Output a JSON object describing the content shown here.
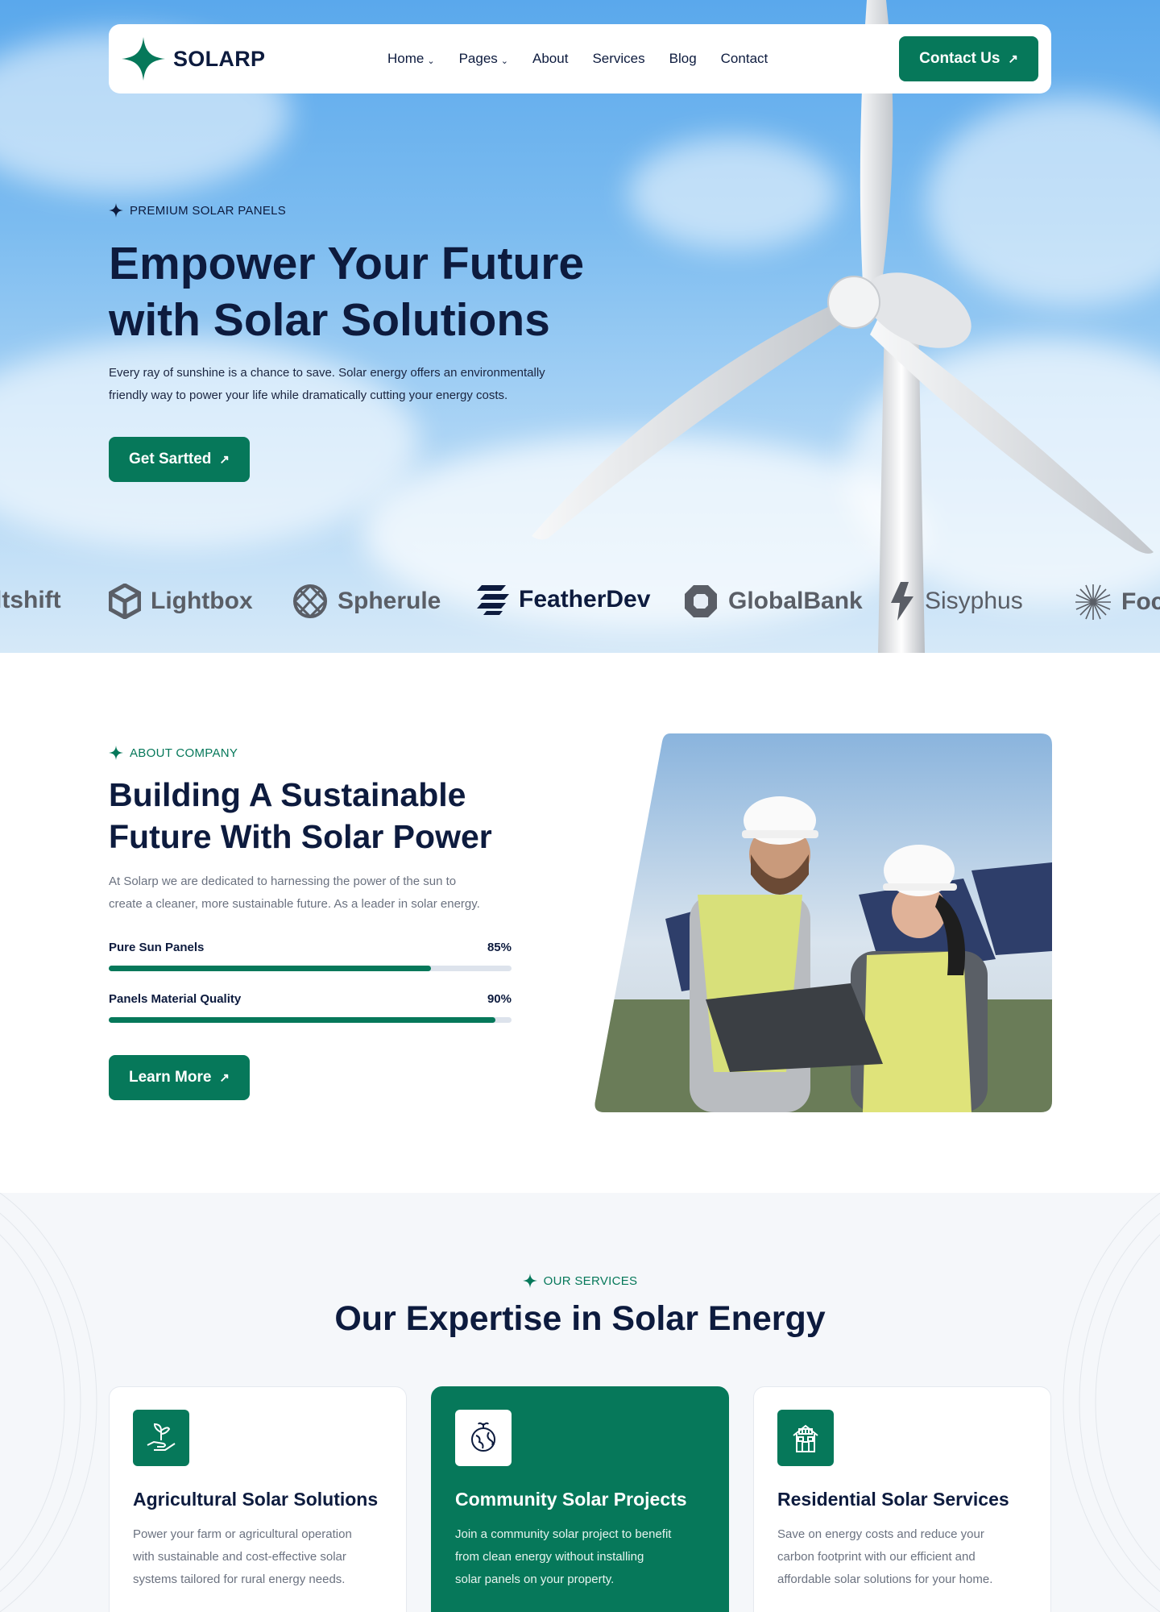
{
  "colors": {
    "brand_green": "#06785a",
    "navy": "#0d1b3e",
    "muted": "#6b7280"
  },
  "nav": {
    "logo_text": "SOLARP",
    "links": [
      {
        "label": "Home",
        "dropdown": true
      },
      {
        "label": "Pages",
        "dropdown": true
      },
      {
        "label": "About",
        "dropdown": false
      },
      {
        "label": "Services",
        "dropdown": false
      },
      {
        "label": "Blog",
        "dropdown": false
      },
      {
        "label": "Contact",
        "dropdown": false
      }
    ],
    "cta_label": "Contact Us"
  },
  "hero": {
    "eyebrow": "PREMIUM SOLAR PANELS",
    "title_line1": "Empower Your Future",
    "title_line2": "with Solar Solutions",
    "desc_line1": "Every ray of sunshine is a chance to save. Solar energy offers an environmentally",
    "desc_line2": "friendly way to power your life while dramatically cutting your energy costs.",
    "cta_label": "Get Sartted"
  },
  "brands": [
    {
      "name": "ltshift",
      "icon": "none"
    },
    {
      "name": "Lightbox",
      "icon": "cube-icon"
    },
    {
      "name": "Spherule",
      "icon": "sphere-icon"
    },
    {
      "name": "FeatherDev",
      "icon": "feather-icon"
    },
    {
      "name": "GlobalBank",
      "icon": "octagon-icon"
    },
    {
      "name": "Sisyphus",
      "icon": "bolt-icon"
    },
    {
      "name": "Foc",
      "icon": "starburst-icon"
    }
  ],
  "about": {
    "eyebrow": "ABOUT COMPANY",
    "title_line1": "Building A Sustainable",
    "title_line2": "Future With Solar Power",
    "desc_line1": "At Solarp we are dedicated to harnessing the power of the sun to",
    "desc_line2": "create a cleaner, more sustainable future. As a leader in solar energy.",
    "skills": [
      {
        "label": "Pure Sun Panels",
        "value_text": "85%",
        "value": 0.8
      },
      {
        "label": "Panels Material Quality",
        "value_text": "90%",
        "value": 0.96
      }
    ],
    "cta_label": "Learn More"
  },
  "services": {
    "eyebrow": "OUR SERVICES",
    "title": "Our Expertise in Solar Energy",
    "cards": [
      {
        "icon": "plant-hand-icon",
        "title": "Agricultural Solar Solutions",
        "desc": [
          "Power your farm or agricultural operation",
          "with sustainable and cost-effective solar",
          "systems tailored for rural energy needs."
        ]
      },
      {
        "icon": "eco-globe-icon",
        "title": "Community Solar Projects",
        "desc": [
          "Join a community solar project to benefit",
          "from clean energy without installing",
          "solar panels on your property."
        ]
      },
      {
        "icon": "solar-house-icon",
        "title": "Residential Solar Services",
        "desc": [
          "Save on energy costs and reduce your",
          "carbon footprint with our efficient and",
          "affordable solar solutions for your home."
        ]
      }
    ]
  }
}
